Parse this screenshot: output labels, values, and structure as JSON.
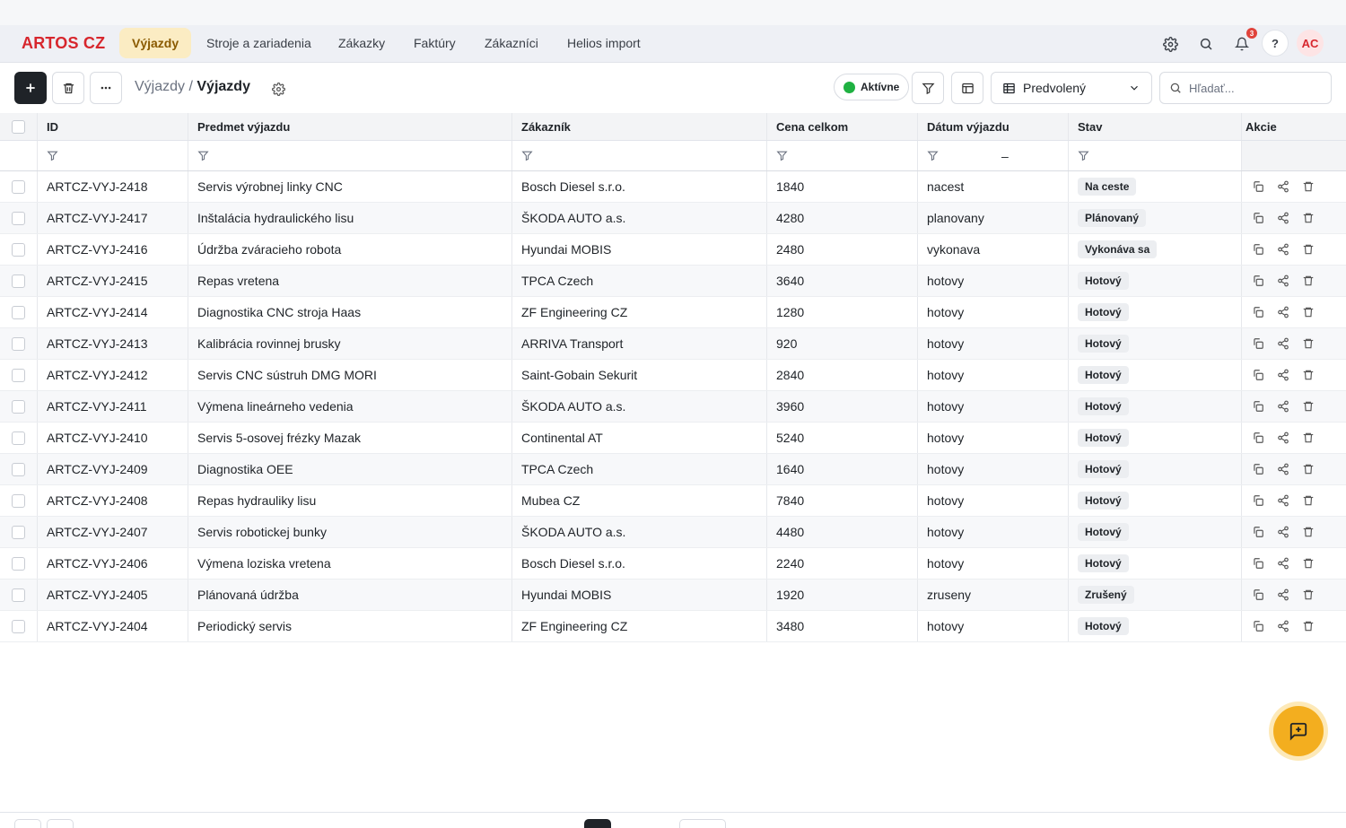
{
  "app": {
    "brand": "ARTOS CZ"
  },
  "nav": {
    "items": [
      {
        "label": "Výjazdy",
        "active": true
      },
      {
        "label": "Stroje a zariadenia",
        "active": false
      },
      {
        "label": "Zákazky",
        "active": false
      },
      {
        "label": "Faktúry",
        "active": false
      },
      {
        "label": "Zákazníci",
        "active": false
      },
      {
        "label": "Helios import",
        "active": false
      }
    ],
    "notification_count": "3",
    "help_label": "?",
    "avatar_initials": "AC",
    "icons": [
      "gear-icon",
      "search-icon",
      "bell-icon"
    ]
  },
  "toolbar": {
    "breadcrumb_parent": "Výjazdy",
    "breadcrumb_sep": " / ",
    "breadcrumb_current": "Výjazdy",
    "active_label": "Aktívne",
    "view_label": "Predvolený",
    "search_placeholder": "Hľadať...",
    "icons": [
      "plus-icon",
      "trash-icon",
      "more-icon",
      "gear-icon",
      "filter-icon",
      "columns-icon",
      "table-icon",
      "chevron-down-icon",
      "search-icon"
    ]
  },
  "table": {
    "columns": [
      "ID",
      "Predmet výjazdu",
      "Zákazník",
      "Cena celkom",
      "Dátum výjazdu",
      "Stav",
      "Akcie"
    ],
    "date_filter_sep": "–",
    "rows": [
      {
        "id": "ARTCZ-VYJ-2418",
        "subject": "Servis výrobnej linky CNC",
        "customer": "Bosch Diesel s.r.o.",
        "price": "1840",
        "date": "nacest",
        "status": "Na ceste"
      },
      {
        "id": "ARTCZ-VYJ-2417",
        "subject": "Inštalácia hydraulického lisu",
        "customer": "ŠKODA AUTO a.s.",
        "price": "4280",
        "date": "planovany",
        "status": "Plánovaný"
      },
      {
        "id": "ARTCZ-VYJ-2416",
        "subject": "Údržba zváracieho robota",
        "customer": "Hyundai MOBIS",
        "price": "2480",
        "date": "vykonava",
        "status": "Vykonáva sa"
      },
      {
        "id": "ARTCZ-VYJ-2415",
        "subject": "Repas vretena",
        "customer": "TPCA Czech",
        "price": "3640",
        "date": "hotovy",
        "status": "Hotový"
      },
      {
        "id": "ARTCZ-VYJ-2414",
        "subject": "Diagnostika CNC stroja Haas",
        "customer": "ZF Engineering CZ",
        "price": "1280",
        "date": "hotovy",
        "status": "Hotový"
      },
      {
        "id": "ARTCZ-VYJ-2413",
        "subject": "Kalibrácia rovinnej brusky",
        "customer": "ARRIVA Transport",
        "price": "920",
        "date": "hotovy",
        "status": "Hotový"
      },
      {
        "id": "ARTCZ-VYJ-2412",
        "subject": "Servis CNC sústruh DMG MORI",
        "customer": "Saint-Gobain Sekurit",
        "price": "2840",
        "date": "hotovy",
        "status": "Hotový"
      },
      {
        "id": "ARTCZ-VYJ-2411",
        "subject": "Výmena lineárneho vedenia",
        "customer": "ŠKODA AUTO a.s.",
        "price": "3960",
        "date": "hotovy",
        "status": "Hotový"
      },
      {
        "id": "ARTCZ-VYJ-2410",
        "subject": "Servis 5-osovej frézky Mazak",
        "customer": "Continental AT",
        "price": "5240",
        "date": "hotovy",
        "status": "Hotový"
      },
      {
        "id": "ARTCZ-VYJ-2409",
        "subject": "Diagnostika OEE",
        "customer": "TPCA Czech",
        "price": "1640",
        "date": "hotovy",
        "status": "Hotový"
      },
      {
        "id": "ARTCZ-VYJ-2408",
        "subject": "Repas hydrauliky lisu",
        "customer": "Mubea CZ",
        "price": "7840",
        "date": "hotovy",
        "status": "Hotový"
      },
      {
        "id": "ARTCZ-VYJ-2407",
        "subject": "Servis robotickej bunky",
        "customer": "ŠKODA AUTO a.s.",
        "price": "4480",
        "date": "hotovy",
        "status": "Hotový"
      },
      {
        "id": "ARTCZ-VYJ-2406",
        "subject": "Výmena loziska vretena",
        "customer": "Bosch Diesel s.r.o.",
        "price": "2240",
        "date": "hotovy",
        "status": "Hotový"
      },
      {
        "id": "ARTCZ-VYJ-2405",
        "subject": "Plánovaná údržba",
        "customer": "Hyundai MOBIS",
        "price": "1920",
        "date": "zruseny",
        "status": "Zrušený"
      },
      {
        "id": "ARTCZ-VYJ-2404",
        "subject": "Periodický servis",
        "customer": "ZF Engineering CZ",
        "price": "3480",
        "date": "hotovy",
        "status": "Hotový"
      }
    ],
    "row_action_icons": [
      "copy-icon",
      "share-icon",
      "trash-icon"
    ]
  },
  "fab": {
    "icon": "chat-plus-icon"
  },
  "colors": {
    "brand": "#d7262d",
    "active_nav_bg": "#fbecc3",
    "fab": "#f3ae1f",
    "active_dot": "#1fb141"
  }
}
